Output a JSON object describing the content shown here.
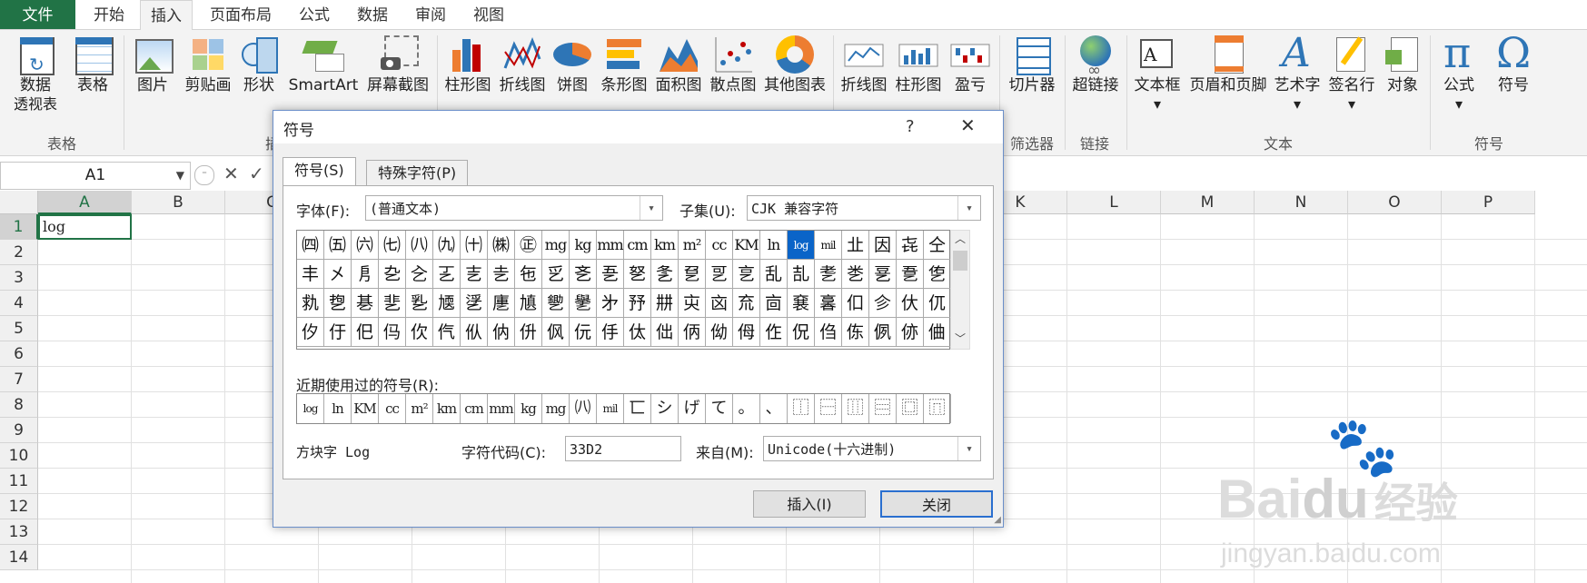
{
  "tabs": [
    "文件",
    "开始",
    "插入",
    "页面布局",
    "公式",
    "数据",
    "审阅",
    "视图"
  ],
  "active_tab": "插入",
  "ribbon": {
    "pivot": [
      "数据",
      "透视表"
    ],
    "table": "表格",
    "picture": "图片",
    "clipart": "剪贴画",
    "shapes": "形状",
    "smartart": "SmartArt",
    "screenshot": "屏幕截图",
    "column_chart": "柱形图",
    "line_chart": "折线图",
    "pie_chart": "饼图",
    "bar_chart": "条形图",
    "area_chart": "面积图",
    "scatter_chart": "散点图",
    "other_chart": "其他图表",
    "spark_line": "折线图",
    "spark_column": "柱形图",
    "spark_winloss": "盈亏",
    "slicer": "切片器",
    "hyperlink": "超链接",
    "textbox": "文本框",
    "header_footer": "页眉和页脚",
    "wordart": "艺术字",
    "signature": "签名行",
    "object": "对象",
    "equation": "公式",
    "symbol": "符号",
    "groups": {
      "tables": "表格",
      "filter": "筛选器",
      "links": "链接",
      "text": "文本",
      "symbols": "符号",
      "cut": "插"
    }
  },
  "formula_bar": {
    "name_box": "A1",
    "cancel": "✕",
    "enter": "✓"
  },
  "grid": {
    "columns": [
      "A",
      "B",
      "C",
      "D",
      "E",
      "F",
      "G",
      "H",
      "I",
      "J",
      "K",
      "L",
      "M",
      "N",
      "O",
      "P"
    ],
    "rows": [
      "1",
      "2",
      "3",
      "4",
      "5",
      "6",
      "7",
      "8",
      "9",
      "10",
      "11",
      "12",
      "13",
      "14"
    ],
    "a1_value": "log"
  },
  "dialog": {
    "title": "符号",
    "help": "?",
    "close_x": "✕",
    "tab_symbols": "符号(S)",
    "tab_special": "特殊字符(P)",
    "font_label": "字体(F):",
    "font_value": "(普通文本)",
    "subset_label": "子集(U):",
    "subset_value": "CJK 兼容字符",
    "symbol_rows": [
      [
        "㈣",
        "㈤",
        "㈥",
        "㈦",
        "㈧",
        "㈨",
        "㈩",
        "㈱",
        "㊣",
        "mg",
        "kg",
        "mm",
        "cm",
        "km",
        "m²",
        "cc",
        "KM",
        "ln",
        "log",
        "mil",
        "㐀",
        "因",
        "㐂",
        "仝"
      ],
      [
        "丰",
        "㐅",
        "㐆",
        "㐇",
        "㐈",
        "㐉",
        "㐊",
        "㐋",
        "㐌",
        "㐍",
        "㐎",
        "㐏",
        "㐐",
        "㐑",
        "㐒",
        "㐓",
        "㐔",
        "乱",
        "㐖",
        "㐗",
        "㐘",
        "㐙",
        "㐚",
        "㐛"
      ],
      [
        "㐜",
        "㐝",
        "㐞",
        "㐟",
        "㐠",
        "㐡",
        "㐢",
        "㐣",
        "㐤",
        "㐥",
        "㐦",
        "㐧",
        "㐨",
        "㐩",
        "㐪",
        "㐫",
        "㐬",
        "㐭",
        "㐮",
        "㐯",
        "㐰",
        "㐱",
        "㐲",
        "㐳"
      ],
      [
        "㐴",
        "㐵",
        "㐶",
        "㐷",
        "㐸",
        "㐹",
        "㐺",
        "㐻",
        "㐼",
        "㐽",
        "㐾",
        "㐿",
        "㑀",
        "㑁",
        "㑂",
        "㑃",
        "㑄",
        "㑅",
        "㑆",
        "㑇",
        "㑈",
        "㑉",
        "㑊",
        "㑋"
      ]
    ],
    "selected_symbol": "log",
    "recent_label": "近期使用过的符号(R):",
    "recent": [
      "log",
      "ln",
      "KM",
      "cc",
      "m²",
      "km",
      "cm",
      "mm",
      "kg",
      "mg",
      "㈧",
      "mil",
      "匸",
      "シ",
      "げ",
      "て",
      "。",
      "、",
      "⿰",
      "⿱",
      "⿲",
      "⿳",
      "⿴",
      "⿵"
    ],
    "char_name": "方块字 Log",
    "code_label": "字符代码(C):",
    "code_value": "33D2",
    "from_label": "来自(M):",
    "from_value": "Unicode(十六进制)",
    "insert_btn": "插入(I)",
    "close_btn": "关闭"
  },
  "watermark": {
    "brand": "Bai",
    "brand2": "du",
    "cn": "经验",
    "url": "jingyan.baidu.com"
  },
  "colors": {
    "excel_green": "#217346",
    "dialog_blue": "#0a64c8"
  }
}
